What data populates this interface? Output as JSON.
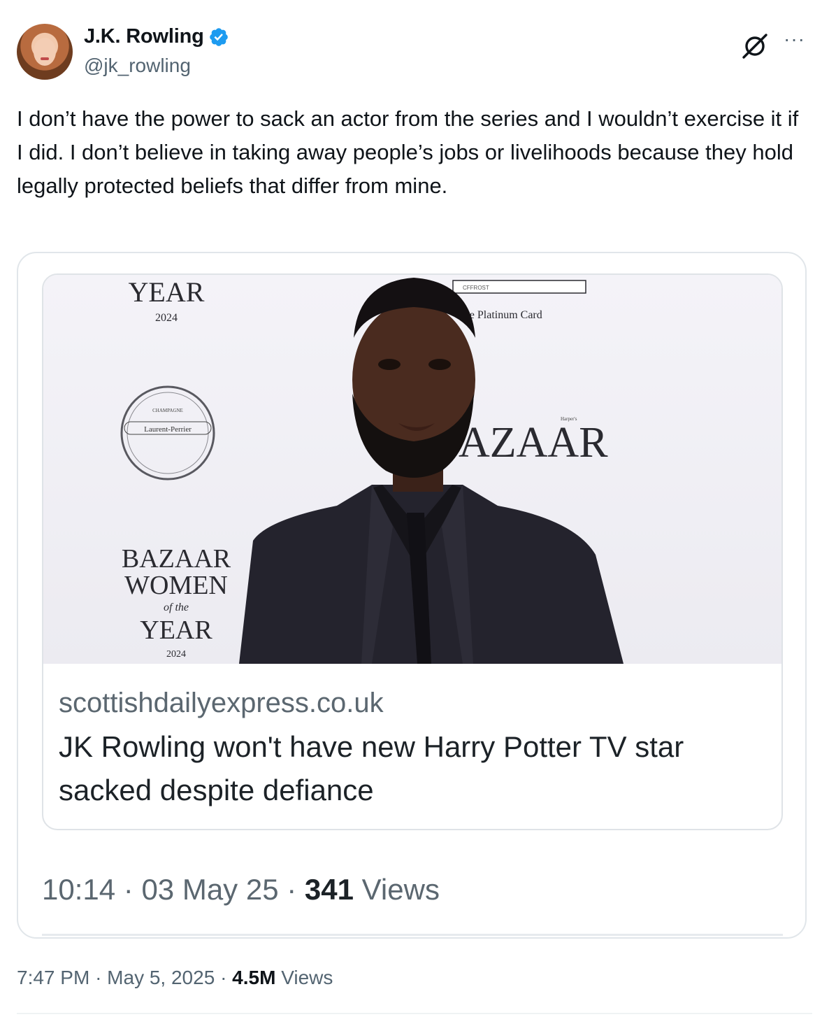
{
  "author": {
    "name": "J.K. Rowling",
    "handle": "@jk_rowling",
    "verified": true,
    "verified_color": "#1d9bf0"
  },
  "icons": {
    "grok": "grok-icon",
    "more": "more-options-icon",
    "more_glyph": "···"
  },
  "tweet": {
    "text": "I don’t have the power to sack an actor from the series and I wouldn’t exercise it if I did. I don’t believe in taking away people’s jobs or livelihoods because they hold legally protected beliefs that differ from mine."
  },
  "quoted": {
    "photo_texts": {
      "year_top": "YEAR",
      "year_top_num": "2024",
      "card_label": "CFFROST",
      "platinum": "The Platinum Card",
      "champagne": "CHAMPAGNE",
      "laurent": "Laurent-Perrier",
      "bazaar_right": "AZAAR",
      "harpers": "Harper's",
      "bazaar": "BAZAAR",
      "women": "WOMEN",
      "of_the": "of the",
      "year_bottom": "YEAR",
      "year_bottom_num": "2024"
    },
    "link": {
      "domain": "scottishdailyexpress.co.uk",
      "title": "JK Rowling won't have new Harry Potter TV star sacked despite defiance"
    },
    "meta": {
      "time": "10:14",
      "date": "03 May 25",
      "views_count": "341",
      "views_label": "Views"
    }
  },
  "meta": {
    "time": "7:47 PM",
    "date": "May 5, 2025",
    "views_count": "4.5M",
    "views_label": "Views",
    "separator": "·"
  }
}
